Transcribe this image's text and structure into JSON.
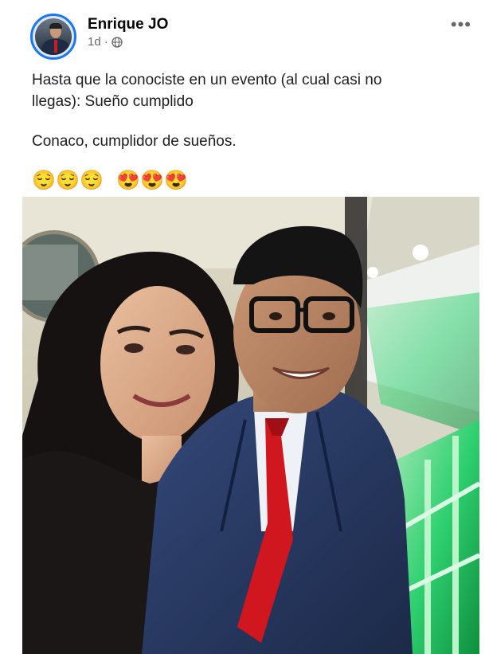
{
  "post": {
    "author": "Enrique JO",
    "time": "1d",
    "separator": "·",
    "privacy_icon": "globe-icon",
    "more_icon": "more-options-icon",
    "more_glyph": "•••",
    "text_line1": "Hasta que la conociste en un evento (al cual casi no",
    "text_line2": "llegas): Sueño cumplido",
    "text_line3": "Conaco, cumplidor de sueños.",
    "emojis_relieved": [
      "😌",
      "😌",
      "😌"
    ],
    "emojis_hearts": [
      "😍",
      "😍",
      "😍"
    ]
  },
  "colors": {
    "accent": "#1877f2",
    "tie": "#d0171f",
    "suit": "#273a5f",
    "green_light": "#2ccf6d"
  }
}
